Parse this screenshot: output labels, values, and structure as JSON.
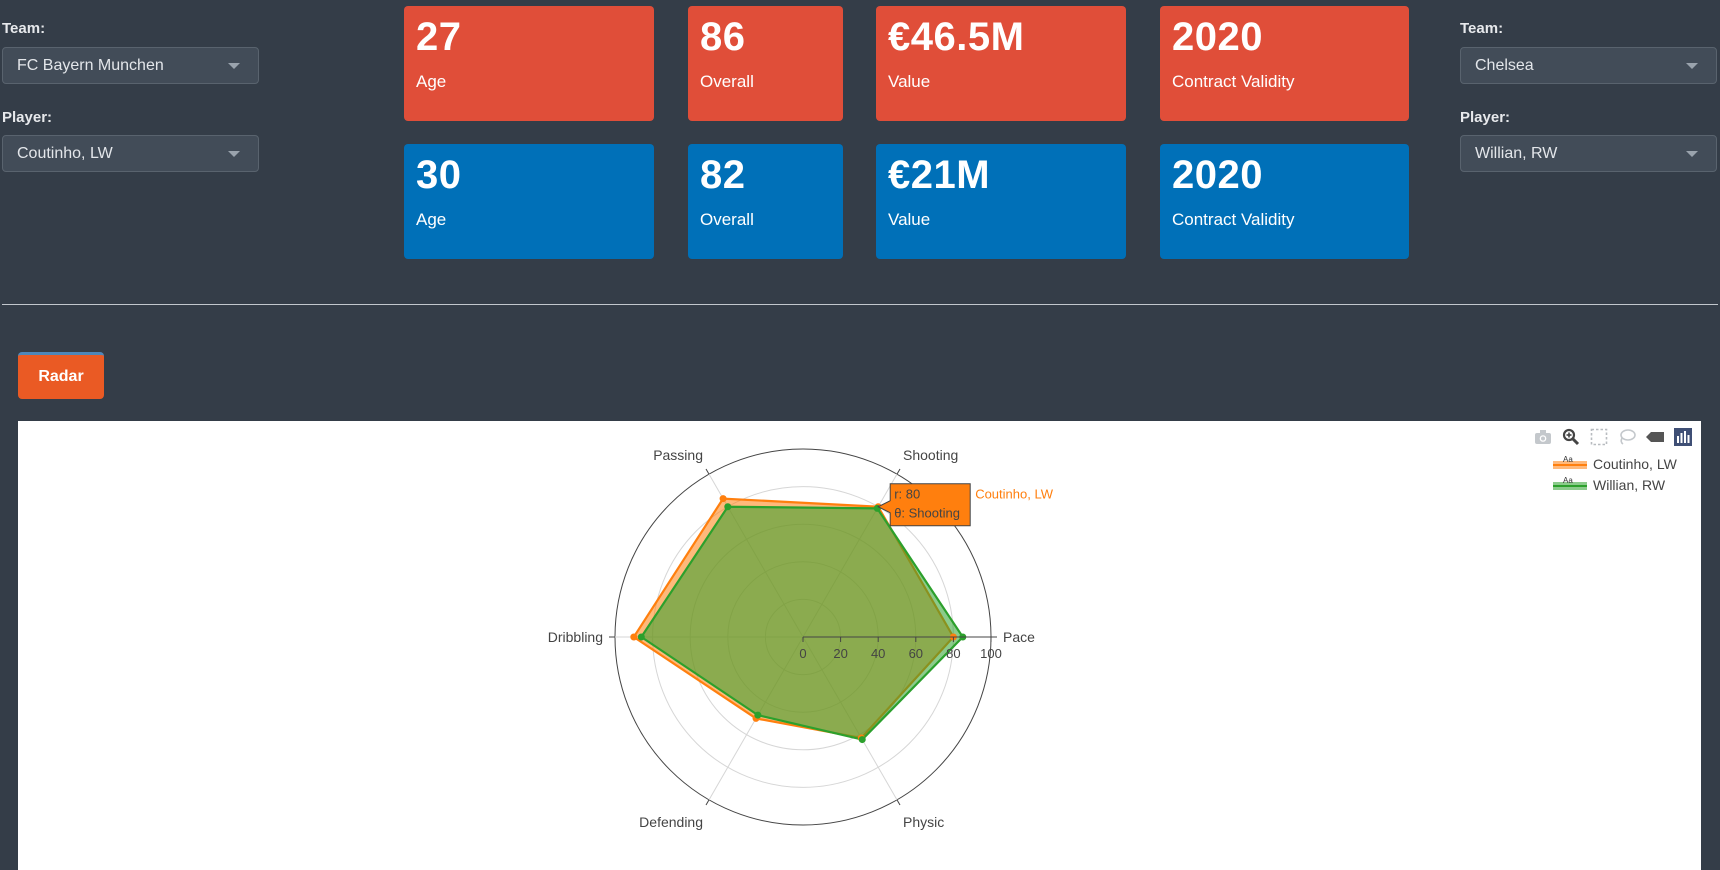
{
  "left": {
    "team_label": "Team:",
    "team_value": "FC Bayern Munchen",
    "player_label": "Player:",
    "player_value": "Coutinho, LW"
  },
  "right": {
    "team_label": "Team:",
    "team_value": "Chelsea",
    "player_label": "Player:",
    "player_value": "Willian, RW"
  },
  "cards_red": [
    {
      "value": "27",
      "label": "Age"
    },
    {
      "value": "86",
      "label": "Overall"
    },
    {
      "value": "€46.5M",
      "label": "Value"
    },
    {
      "value": "2020",
      "label": "Contract Validity"
    }
  ],
  "cards_blue": [
    {
      "value": "30",
      "label": "Age"
    },
    {
      "value": "82",
      "label": "Overall"
    },
    {
      "value": "€21M",
      "label": "Value"
    },
    {
      "value": "2020",
      "label": "Contract Validity"
    }
  ],
  "tab_label": "Radar",
  "colors": {
    "red_card": "#e04e39",
    "blue_card": "#0070b8",
    "series1": "#ff7f0e",
    "series2": "#2ca02c",
    "tab": "#ea5a24"
  },
  "modebar_icons": [
    "camera-icon",
    "zoom-icon",
    "box-select-icon",
    "lasso-icon",
    "hover-closest-icon",
    "plotly-logo-icon"
  ],
  "hover": {
    "r_text": "r: 80",
    "theta_text": "θ: Shooting",
    "series": "Coutinho, LW"
  },
  "chart_data": {
    "type": "radar",
    "categories": [
      "Pace",
      "Shooting",
      "Passing",
      "Dribbling",
      "Defending",
      "Physic"
    ],
    "radial_ticks": [
      "0",
      "20",
      "40",
      "60",
      "80",
      "100"
    ],
    "radial_range": [
      0,
      100
    ],
    "series": [
      {
        "name": "Coutinho, LW",
        "values": [
          80,
          80,
          85,
          90,
          50,
          62
        ]
      },
      {
        "name": "Willian, RW",
        "values": [
          85,
          79,
          80,
          86,
          48,
          63
        ]
      }
    ],
    "legend_position": "top-right"
  }
}
